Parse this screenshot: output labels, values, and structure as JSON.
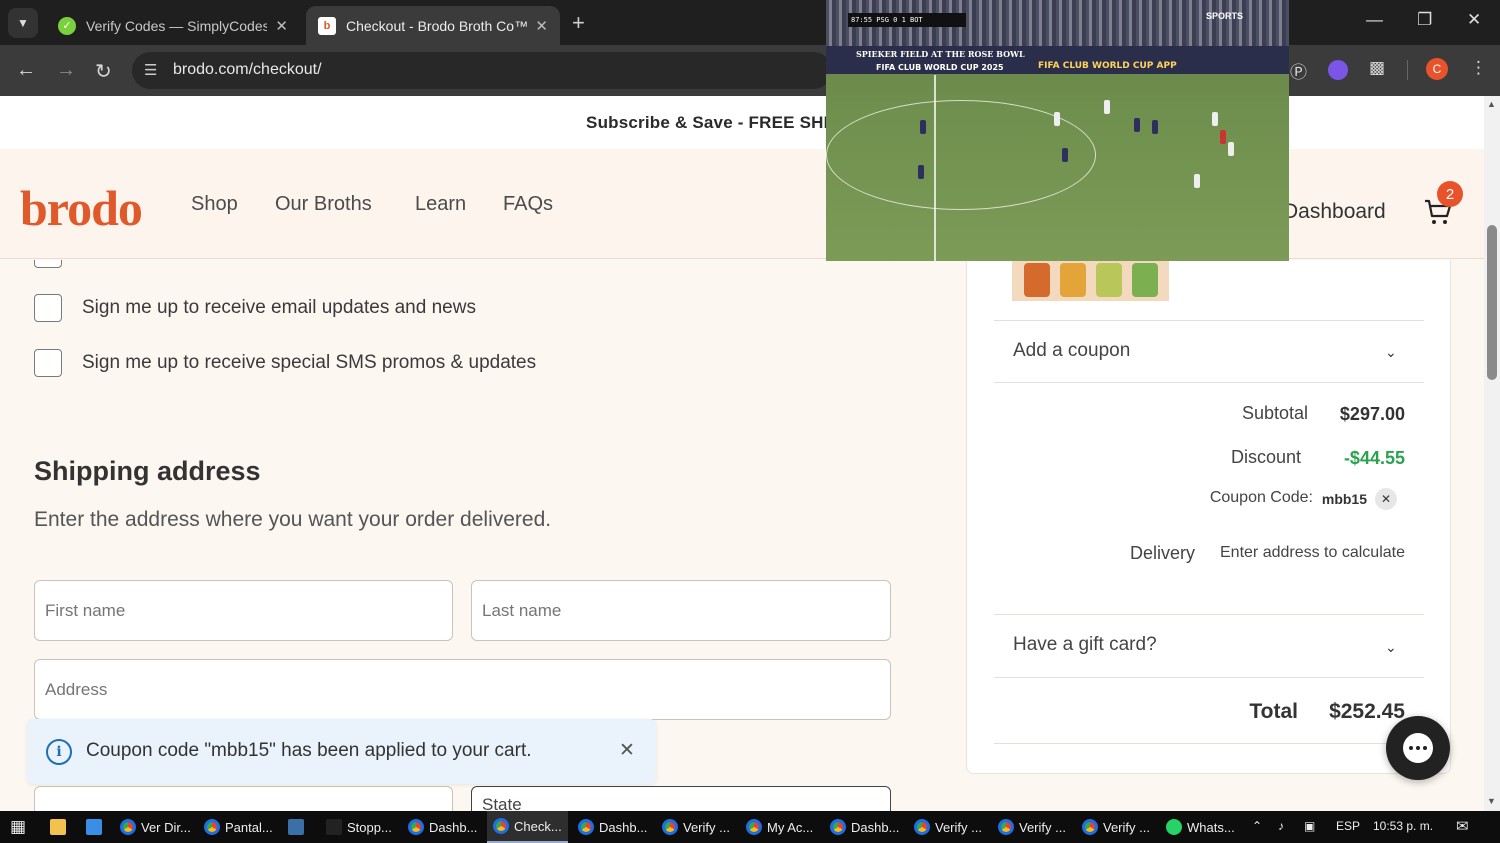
{
  "browser": {
    "tabs": [
      {
        "title": "Verify Codes — SimplyCodes",
        "active": false
      },
      {
        "title": "Checkout - Brodo Broth Co™",
        "active": true
      }
    ],
    "url": "brodo.com/checkout/",
    "profile_initial": "C"
  },
  "page": {
    "promo_banner": "Subscribe & Save - FREE SHIPPING o",
    "logo": "brodo",
    "nav": [
      "Shop",
      "Our Broths",
      "Learn",
      "FAQs"
    ],
    "dashboard_label": "Dashboard",
    "cart_count": "2",
    "checkboxes": {
      "email": "Sign me up to receive email updates and news",
      "sms": "Sign me up to receive special SMS promos & updates"
    },
    "shipping": {
      "title": "Shipping address",
      "subtitle": "Enter the address where you want your order delivered.",
      "first_name_placeholder": "First name",
      "last_name_placeholder": "Last name",
      "address_placeholder": "Address",
      "state_label": "State"
    },
    "toast": {
      "message": "Coupon code \"mbb15\" has been applied to your cart."
    },
    "summary": {
      "coupon_toggle": "Add a coupon",
      "subtotal_label": "Subtotal",
      "subtotal_value": "$297.00",
      "discount_label": "Discount",
      "discount_value": "-$44.55",
      "coupon_code_label": "Coupon Code:",
      "coupon_code_value": "mbb15",
      "delivery_label": "Delivery",
      "delivery_value": "Enter address to calculate",
      "gift_card_toggle": "Have a gift card?",
      "total_label": "Total",
      "total_value": "$252.45"
    }
  },
  "pip_video": {
    "scoreboard": "87:55 PSG 0 1 BOT",
    "channel": "SPORTS",
    "banner_left": "SPIEKER FIELD AT THE ROSE BOWL",
    "banner_mid": "FIFA CLUB WORLD CUP 2025",
    "banner_right": "FIFA CLUB WORLD CUP APP"
  },
  "taskbar": {
    "items": [
      "Ver Dir...",
      "Pantal...",
      "Stopp...",
      "Dashb...",
      "Check...",
      "Dashb...",
      "Verify ...",
      "My Ac...",
      "Dashb...",
      "Verify ...",
      "Verify ...",
      "Verify ...",
      "Whats..."
    ],
    "language": "ESP",
    "clock": "10:53 p. m."
  },
  "colors": {
    "brand_orange": "#e0592a",
    "discount_green": "#2aa24f",
    "page_bg": "#fdf7f1",
    "toast_bg": "#eaf3fb"
  }
}
